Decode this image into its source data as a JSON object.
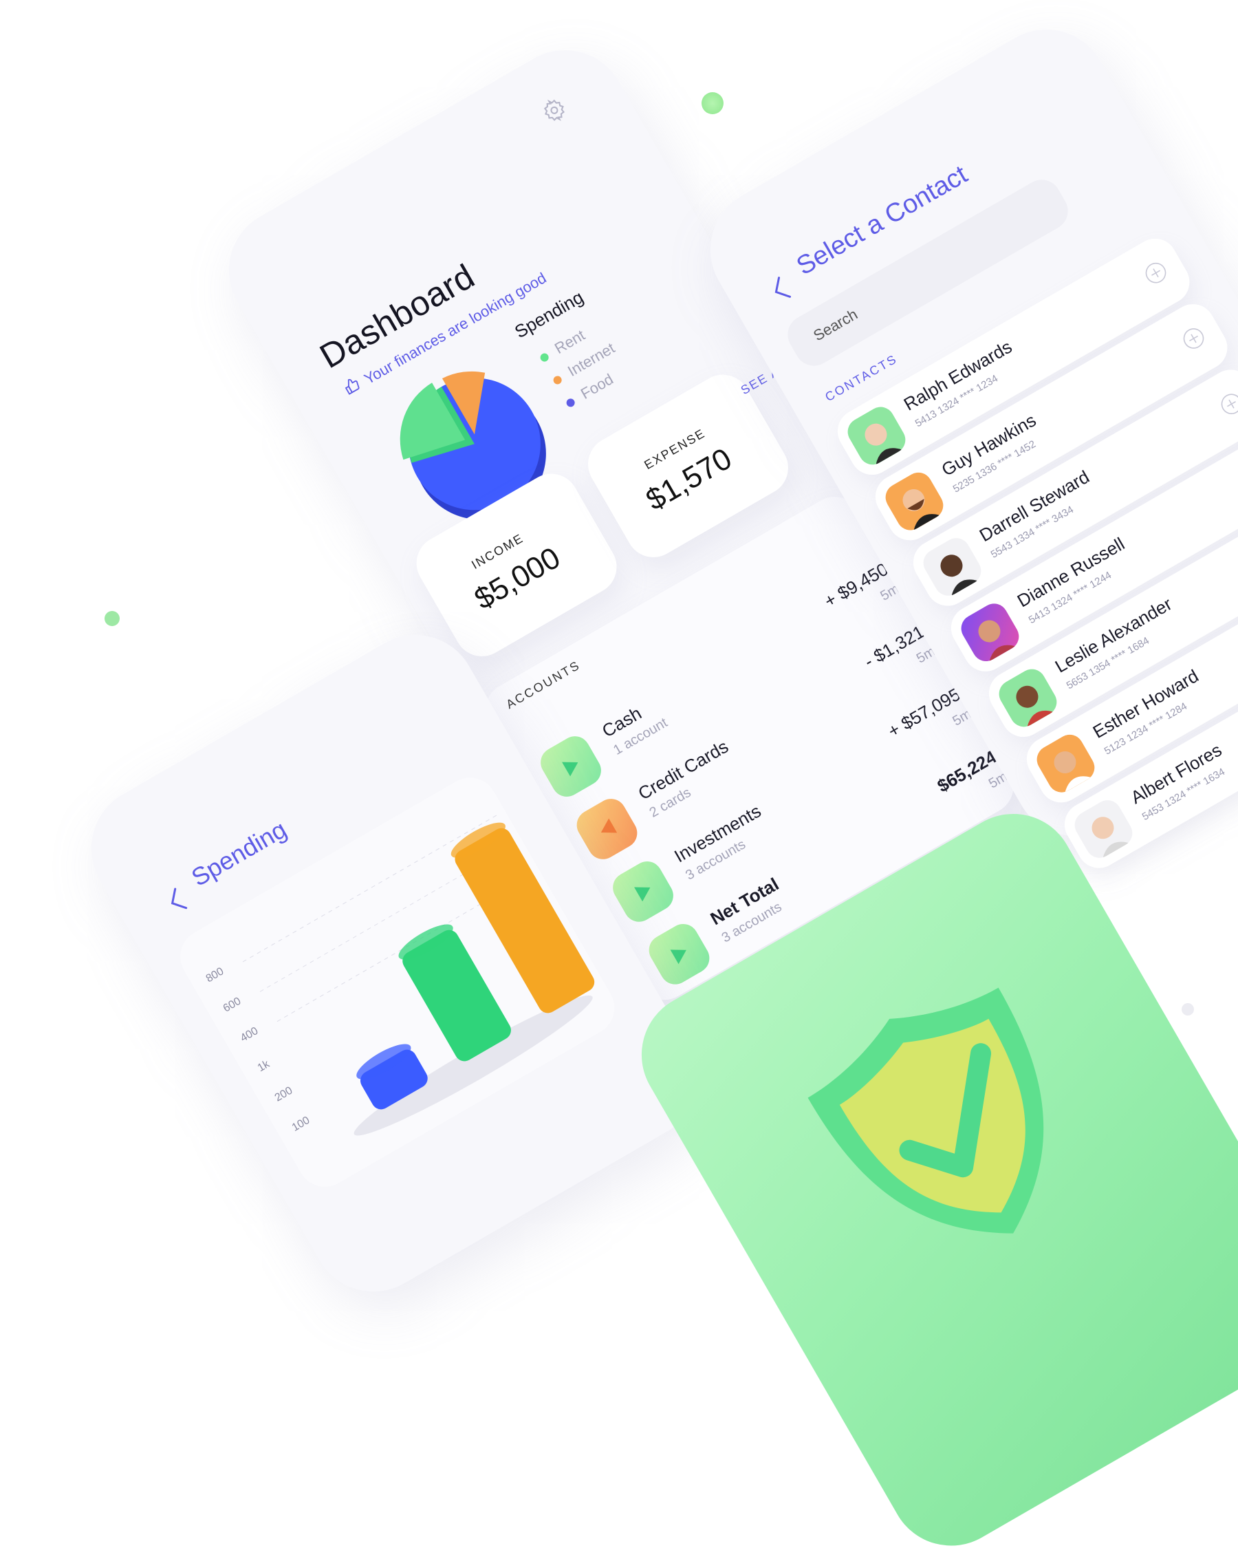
{
  "dashboard": {
    "title": "Dashboard",
    "subtitle": "Your finances are looking good",
    "spending": {
      "title": "Spending",
      "legend": [
        {
          "label": "Rent",
          "color": "#62e58d"
        },
        {
          "label": "Internet",
          "color": "#f6a04d"
        },
        {
          "label": "Food",
          "color": "#5e5ce6"
        }
      ]
    },
    "income": {
      "label": "INCOME",
      "value": "$5,000"
    },
    "expense": {
      "label": "EXPENSE",
      "value": "$1,570"
    },
    "see_all": "SEE ALL",
    "accounts_label": "ACCOUNTS",
    "accounts": [
      {
        "name": "Cash",
        "sub": "1 account",
        "amount": "+ $9,450",
        "time": "5m",
        "icon": "play-icon"
      },
      {
        "name": "Credit Cards",
        "sub": "2 cards",
        "amount": "- $1,321",
        "time": "5m",
        "icon": "rewind-icon"
      },
      {
        "name": "Investments",
        "sub": "3 accounts",
        "amount": "+ $57,095",
        "time": "5m",
        "icon": "play-icon"
      },
      {
        "name": "Net Total",
        "sub": "3 accounts",
        "amount": "$65,224",
        "time": "5m",
        "icon": "play-icon"
      }
    ]
  },
  "contacts": {
    "title": "Select a Contact",
    "search_placeholder": "Search",
    "label": "CONTACTS",
    "items": [
      {
        "name": "Ralph Edwards",
        "number": "5413 1324 **** 1234",
        "avatar_bg": "#8ee6a0"
      },
      {
        "name": "Guy Hawkins",
        "number": "5235 1336 **** 1452",
        "avatar_bg": "#f8a751"
      },
      {
        "name": "Darrell Steward",
        "number": "5543 1334 **** 3434",
        "avatar_bg": "#f2f2f5"
      },
      {
        "name": "Dianne Russell",
        "number": "5413 1324 **** 1244",
        "avatar_bg": "#7d4ef2"
      },
      {
        "name": "Leslie Alexander",
        "number": "5653 1354 **** 1684",
        "avatar_bg": "#8ee6a0"
      },
      {
        "name": "Esther Howard",
        "number": "5123 1234 **** 1284",
        "avatar_bg": "#f8a751"
      },
      {
        "name": "Albert Flores",
        "number": "5453 1324 **** 1634",
        "avatar_bg": "#f2f2f5"
      }
    ]
  },
  "spending_screen": {
    "title": "Spending",
    "y_ticks": [
      "800",
      "600",
      "400",
      "1k",
      "200",
      "100"
    ]
  },
  "chart_data": {
    "type": "bar",
    "title": "Spending",
    "categories": [
      "",
      "",
      ""
    ],
    "y_ticks": [
      "800",
      "600",
      "400",
      "1k",
      "200",
      "100"
    ],
    "values": [
      200,
      600,
      900
    ],
    "colors": [
      "#3b5cff",
      "#2fd47a",
      "#f5a623"
    ]
  },
  "colors": {
    "accent": "#5e5ce6",
    "green": "#62e58d",
    "orange": "#f6a04d",
    "blue": "#3b5cff"
  }
}
